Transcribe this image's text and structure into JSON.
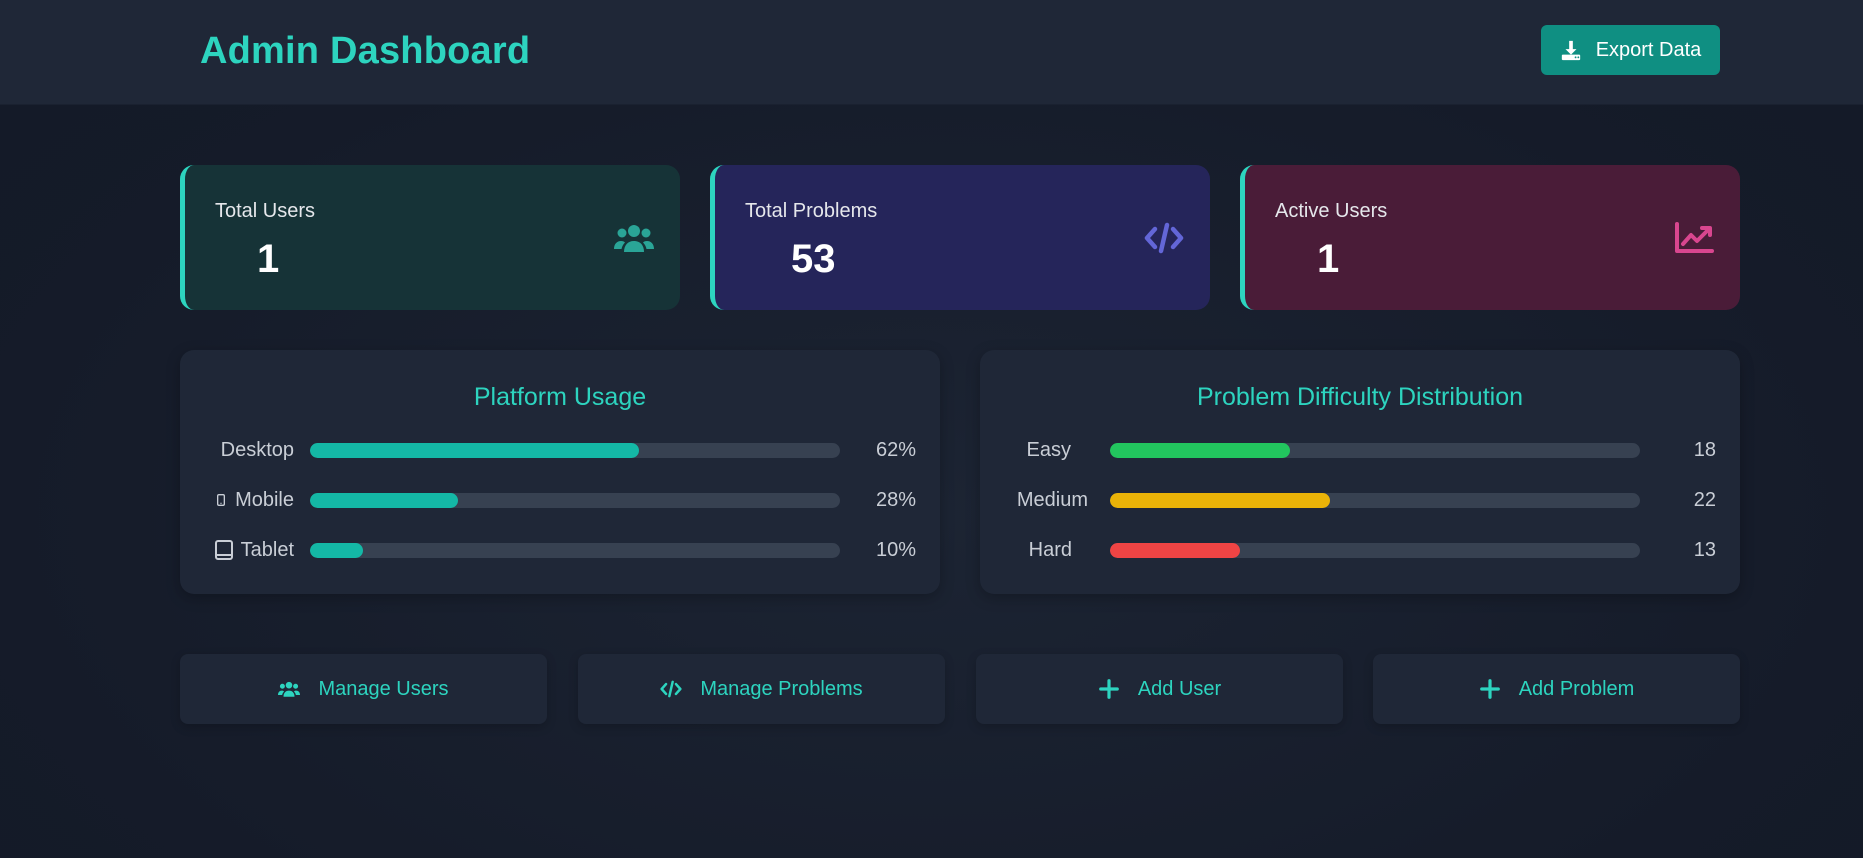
{
  "header": {
    "title": "Admin Dashboard",
    "export_label": "Export Data"
  },
  "stats": [
    {
      "label": "Total Users",
      "value": "1",
      "icon": "users-icon",
      "bg": "#163337",
      "icon_color": "#2aa597"
    },
    {
      "label": "Total Problems",
      "value": "53",
      "icon": "code-icon",
      "bg": "#25255a",
      "icon_color": "#6366d8"
    },
    {
      "label": "Active Users",
      "value": "1",
      "icon": "chart-line-icon",
      "bg": "#4a1c38",
      "icon_color": "#d9468f"
    }
  ],
  "platform_usage": {
    "title": "Platform Usage",
    "rows": [
      {
        "label": "Desktop",
        "value": "62%",
        "percent": 62,
        "icon": ""
      },
      {
        "label": "Mobile",
        "value": "28%",
        "percent": 28,
        "icon": "mobile-icon"
      },
      {
        "label": "Tablet",
        "value": "10%",
        "percent": 10,
        "icon": "tablet-icon"
      }
    ],
    "bar_color": "#14b8a6"
  },
  "difficulty": {
    "title": "Problem Difficulty Distribution",
    "rows": [
      {
        "label": "Easy",
        "value": "18",
        "percent": 34,
        "color": "#22c55e"
      },
      {
        "label": "Medium",
        "value": "22",
        "percent": 41.5,
        "color": "#eab308"
      },
      {
        "label": "Hard",
        "value": "13",
        "percent": 24.5,
        "color": "#ef4444"
      }
    ]
  },
  "actions": [
    {
      "label": "Manage Users",
      "icon": "users-icon"
    },
    {
      "label": "Manage Problems",
      "icon": "code-icon"
    },
    {
      "label": "Add User",
      "icon": "plus-icon"
    },
    {
      "label": "Add Problem",
      "icon": "plus-icon"
    }
  ],
  "colors": {
    "accent": "#2dd4bf",
    "background": "#151c2b",
    "panel": "#1f2737",
    "track": "#374151"
  }
}
